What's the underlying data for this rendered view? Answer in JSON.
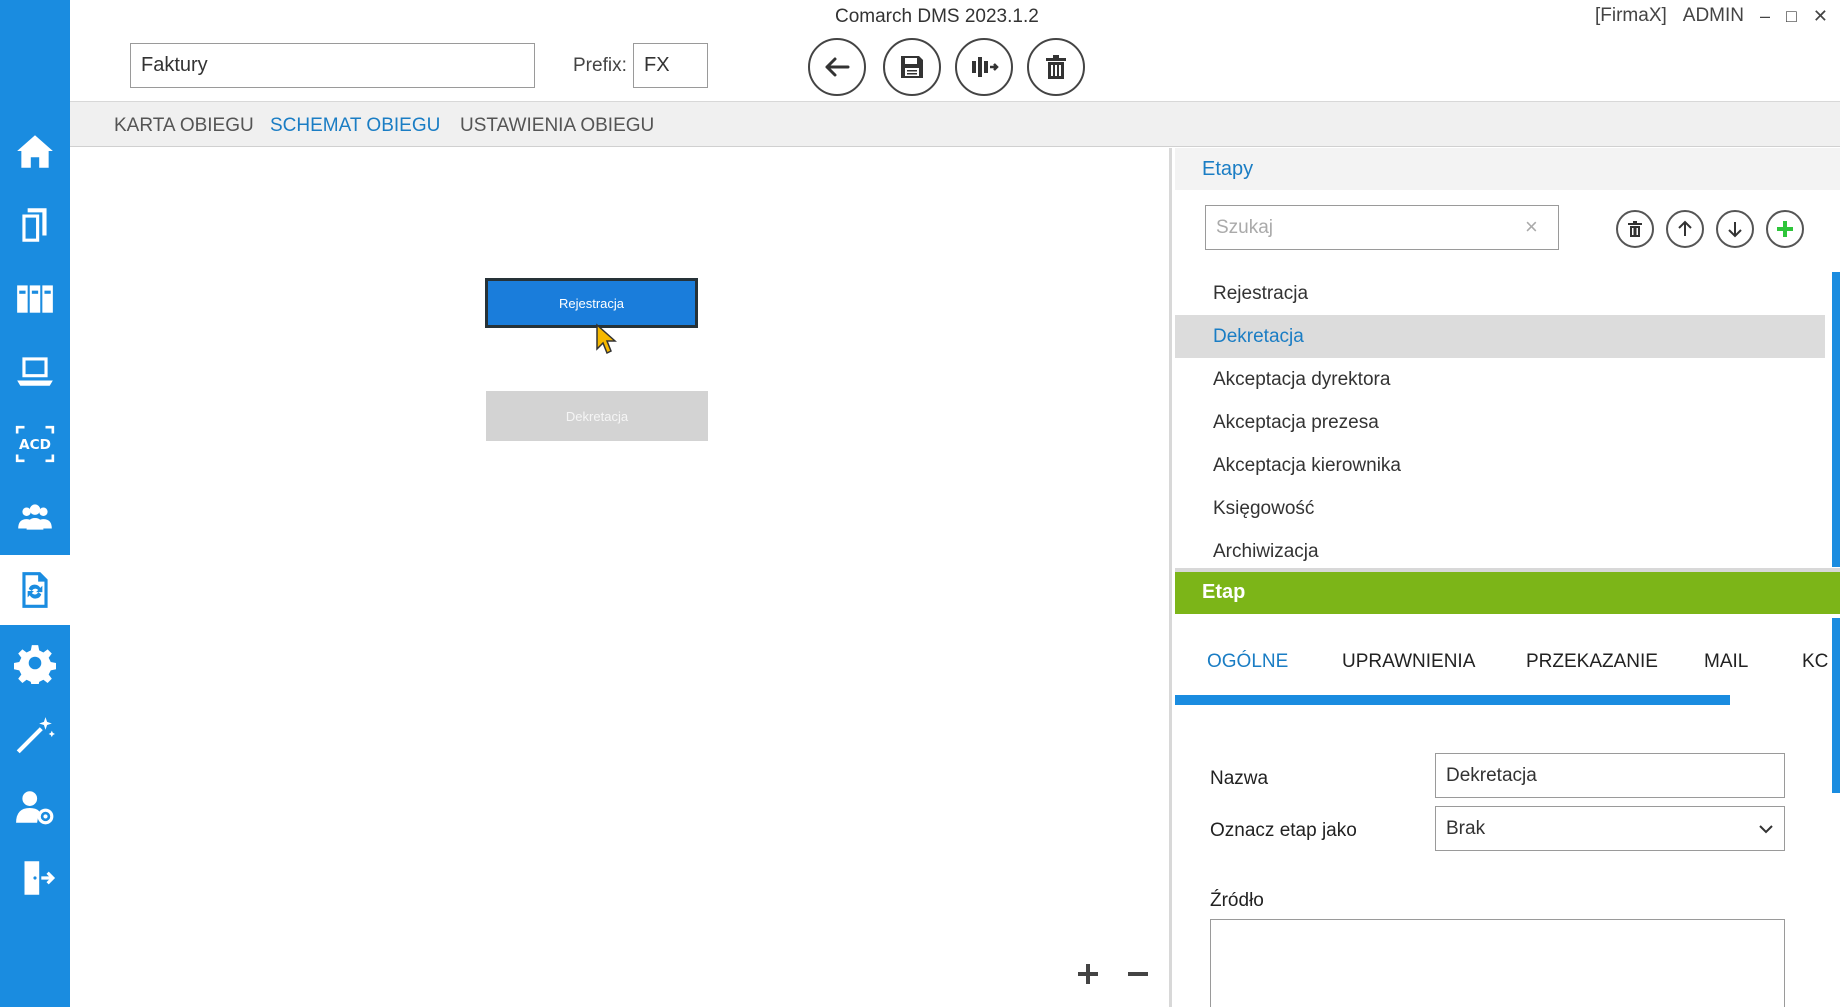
{
  "window": {
    "title": "Comarch DMS 2023.1.2",
    "company": "[FirmaX]",
    "user": "ADMIN",
    "minimize": "–",
    "maximize": "□",
    "close": "✕"
  },
  "sidebar": {
    "items": [
      {
        "icon": "home-icon",
        "active": false
      },
      {
        "icon": "documents-icon",
        "active": false
      },
      {
        "icon": "binders-icon",
        "active": false
      },
      {
        "icon": "laptop-icon",
        "active": false
      },
      {
        "icon": "ocr-acd-icon",
        "active": false
      },
      {
        "icon": "users-group-icon",
        "active": false
      },
      {
        "icon": "workflow-document-icon",
        "active": true
      },
      {
        "icon": "gear-icon",
        "active": false
      },
      {
        "icon": "magic-wand-icon",
        "active": false
      },
      {
        "icon": "user-settings-icon",
        "active": false
      },
      {
        "icon": "logout-door-icon",
        "active": false
      }
    ]
  },
  "header": {
    "name_value": "Faktury",
    "prefix_label": "Prefix:",
    "prefix_value": "FX",
    "buttons": [
      "back-arrow-icon",
      "save-disk-icon",
      "workflow-add-icon",
      "trash-icon"
    ]
  },
  "tabs": [
    {
      "label": "KARTA OBIEGU",
      "active": false
    },
    {
      "label": "SCHEMAT OBIEGU",
      "active": true
    },
    {
      "label": "USTAWIENIA OBIEGU",
      "active": false
    }
  ],
  "canvas": {
    "nodes": [
      {
        "label": "Rejestracja",
        "selected": true
      },
      {
        "label": "Dekretacja",
        "selected": false
      }
    ],
    "zoom_in": "+",
    "zoom_out": "–"
  },
  "stages_panel": {
    "title": "Etapy",
    "search_placeholder": "Szukaj",
    "clear": "×",
    "stages": [
      {
        "label": "Rejestracja",
        "selected": false
      },
      {
        "label": "Dekretacja",
        "selected": true
      },
      {
        "label": "Akceptacja dyrektora",
        "selected": false
      },
      {
        "label": "Akceptacja prezesa",
        "selected": false
      },
      {
        "label": "Akceptacja kierownika",
        "selected": false
      },
      {
        "label": "Księgowość",
        "selected": false
      },
      {
        "label": "Archiwizacja",
        "selected": false
      }
    ]
  },
  "stage_detail": {
    "title": "Etap",
    "tabs": [
      {
        "label": "OGÓLNE",
        "active": true
      },
      {
        "label": "UPRAWNIENIA",
        "active": false
      },
      {
        "label": "PRZEKAZANIE",
        "active": false
      },
      {
        "label": "MAIL",
        "active": false
      },
      {
        "label": "KC",
        "active": false
      }
    ],
    "name_label": "Nazwa",
    "name_value": "Dekretacja",
    "mark_label": "Oznacz etap jako",
    "mark_value": "Brak",
    "source_label": "Źródło"
  },
  "colors": {
    "sidebar": "#1a8ce0",
    "accent": "#1a7dc4",
    "etap_bar": "#7cb518",
    "selected_node": "#1a7ddb"
  }
}
